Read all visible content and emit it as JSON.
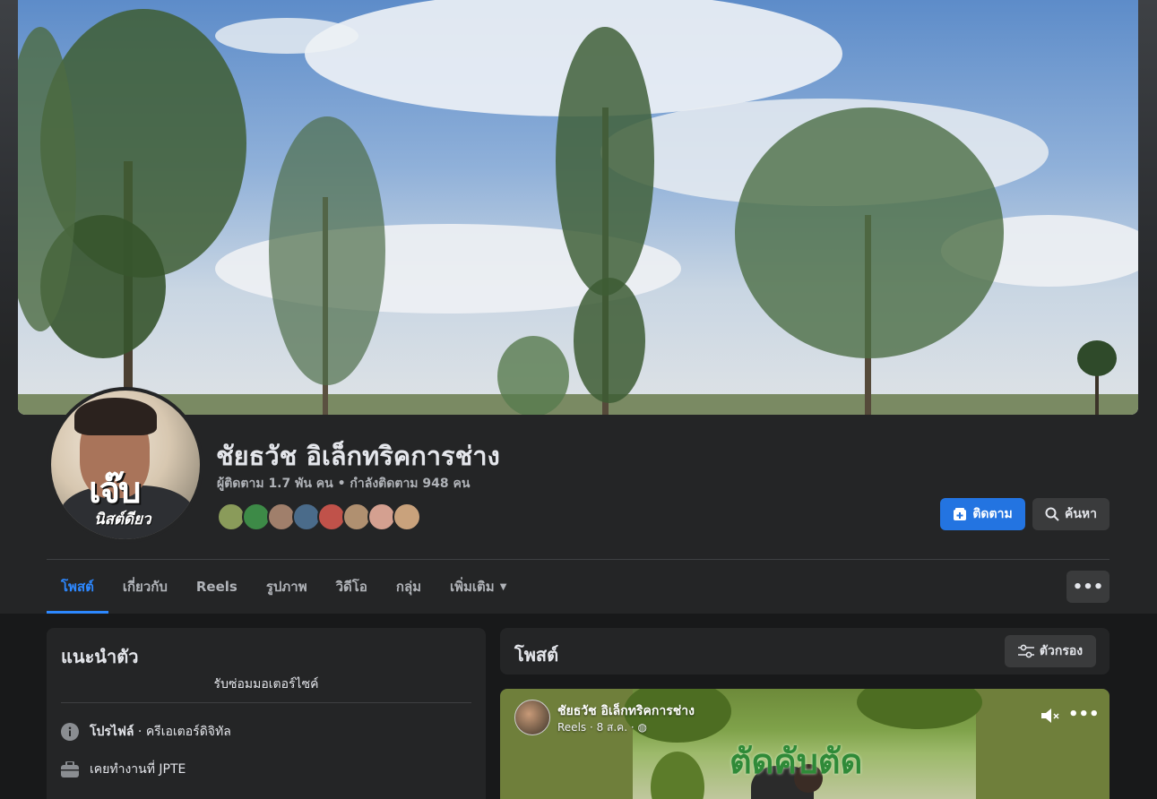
{
  "profile": {
    "name": "ชัยธวัช อิเล็กทริคการช่าง",
    "stats": "ผู้ติดตาม 1.7 พัน คน • กำลังติดตาม 948 คน",
    "avatar_logo_text": "เจ๊บ",
    "avatar_logo_sub": "นิสต์ดียว"
  },
  "friends": [
    {
      "color": "#8a9b5a"
    },
    {
      "color": "#3d8a47"
    },
    {
      "color": "#a07f6b"
    },
    {
      "color": "#4a6b8a"
    },
    {
      "color": "#c0524a"
    },
    {
      "color": "#b09070"
    },
    {
      "color": "#d4a090"
    },
    {
      "color": "#c9a27c"
    }
  ],
  "actions": {
    "follow_label": "ติดตาม",
    "search_label": "ค้นหา",
    "more_label": "•••"
  },
  "tabs": [
    {
      "label": "โพสต์",
      "active": true
    },
    {
      "label": "เกี่ยวกับ",
      "active": false
    },
    {
      "label": "Reels",
      "active": false
    },
    {
      "label": "รูปภาพ",
      "active": false
    },
    {
      "label": "วิดีโอ",
      "active": false
    },
    {
      "label": "กลุ่ม",
      "active": false
    },
    {
      "label": "เพิ่มเติม",
      "active": false
    }
  ],
  "intro": {
    "title": "แนะนำตัว",
    "bio": "รับซ่อมมอเตอร์ไซค์",
    "profile_bold": "โปรไฟล์",
    "profile_rest": " · ครีเอเตอร์ดิจิทัล",
    "work": "เคยทำงานที่ JPTE"
  },
  "posts": {
    "title": "โพสต์",
    "filter_label": "ตัวกรอง"
  },
  "post": {
    "author": "ชัยธวัช อิเล็กทริคการช่าง",
    "meta": "Reels · 8 ส.ค. · ",
    "overlay_text": "ตัดคับตัด",
    "options_label": "•••"
  },
  "colors": {
    "accent": "#2d88ff",
    "button_primary": "#2374e1",
    "card_bg": "#242526",
    "page_bg": "#18191a"
  }
}
